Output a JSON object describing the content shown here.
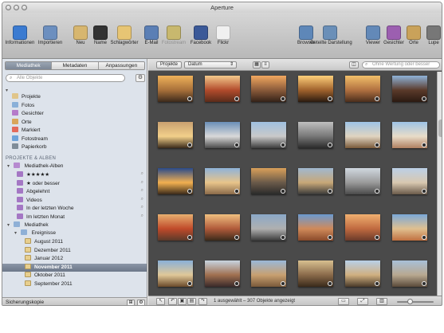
{
  "window": {
    "title": "Aperture"
  },
  "toolbar": {
    "left": [
      {
        "label": "Informationen",
        "icon": "info-icon",
        "color": "#3b7bd1"
      },
      {
        "label": "Importieren",
        "icon": "import-arrow-icon",
        "color": "#6c8fbf"
      },
      {
        "label": "Neu",
        "icon": "new-project-icon",
        "color": "#d7b66f"
      },
      {
        "label": "Name",
        "icon": "person-icon",
        "color": "#333333"
      },
      {
        "label": "Schlagwörter",
        "icon": "keyword-tag-icon",
        "color": "#e7c574"
      },
      {
        "label": "E-Mail",
        "icon": "email-icon",
        "color": "#5b7fb5"
      },
      {
        "label": "Fotostream",
        "icon": "photostream-icon",
        "color": "#c8b86e",
        "dim": true
      },
      {
        "label": "Facebook",
        "icon": "facebook-icon",
        "color": "#3b5998"
      },
      {
        "label": "Flickr",
        "icon": "flickr-icon",
        "color": "#f0f0f0"
      }
    ],
    "right": [
      {
        "label": "Browser",
        "icon": "browser-icon",
        "color": "#5e87b8"
      },
      {
        "label": "Geteilte Darstellung",
        "icon": "split-view-icon",
        "color": "#6a8fb8"
      },
      {
        "label": "Viewer",
        "icon": "viewer-icon",
        "color": "#6389b8"
      },
      {
        "label": "Gesichter",
        "icon": "faces-icon",
        "color": "#9c5fb0"
      },
      {
        "label": "Orte",
        "icon": "places-icon",
        "color": "#c9a25a"
      },
      {
        "label": "Lupe",
        "icon": "loupe-icon",
        "color": "#777777"
      }
    ]
  },
  "sidebar": {
    "tabs": [
      {
        "label": "Mediathek",
        "active": true
      },
      {
        "label": "Metadaten",
        "active": false
      },
      {
        "label": "Anpassungen",
        "active": false
      }
    ],
    "search_placeholder": "Alle Objekte",
    "library_items": [
      {
        "label": "Projekte",
        "icon": "projects-icon",
        "color": "#e0c58a"
      },
      {
        "label": "Fotos",
        "icon": "photos-icon",
        "color": "#8ab0d8"
      },
      {
        "label": "Gesichter",
        "icon": "faces-icon",
        "color": "#b57bc9"
      },
      {
        "label": "Orte",
        "icon": "places-icon",
        "color": "#d9a65a"
      },
      {
        "label": "Markiert",
        "icon": "flag-icon",
        "color": "#e36a5a"
      },
      {
        "label": "Fotostream",
        "icon": "photostream-icon",
        "color": "#6ea3d9"
      },
      {
        "label": "Papierkorb",
        "icon": "trash-icon",
        "color": "#7f8c98"
      }
    ],
    "section_label": "PROJEKTE & ALBEN",
    "albums_group": "Mediathek-Alben",
    "albums": [
      {
        "label": "★★★★★"
      },
      {
        "label": "★ oder besser"
      },
      {
        "label": "Abgelehnt"
      },
      {
        "label": "Videos"
      },
      {
        "label": "In der letzten Woche"
      },
      {
        "label": "Im letzten Monat"
      }
    ],
    "library_folder": "Mediathek",
    "events_folder": "Ereignisse",
    "events": [
      {
        "label": "August 2011",
        "selected": false
      },
      {
        "label": "Dezember 2011",
        "selected": false
      },
      {
        "label": "Januar 2012",
        "selected": false
      },
      {
        "label": "November 2011",
        "selected": true
      },
      {
        "label": "Oktober 2011",
        "selected": false
      },
      {
        "label": "September 2011",
        "selected": false
      }
    ],
    "bottom_label": "Sicherungskopie"
  },
  "browser": {
    "scope_button": "Projekte",
    "sort_select": "Datum",
    "filter_placeholder": "Ohne Wertung oder besser",
    "status": "1 ausgewählt – 307 Objekte angezeigt",
    "thumb_zoom": 0.35,
    "thumbnails": [
      {
        "colors": [
          "#f0b25a",
          "#a8703a",
          "#3c2a1c"
        ]
      },
      {
        "colors": [
          "#f3c98c",
          "#b24b2c",
          "#5a2b1a"
        ]
      },
      {
        "colors": [
          "#f2a860",
          "#8a5a3a",
          "#332218"
        ]
      },
      {
        "colors": [
          "#ffd07a",
          "#a0622c",
          "#2a1b10"
        ]
      },
      {
        "colors": [
          "#f2c06a",
          "#b07040",
          "#4a2e1c"
        ]
      },
      {
        "colors": [
          "#8fb3d9",
          "#5a3a2a",
          "#2b1a12"
        ]
      },
      {
        "colors": [
          "#c8a070",
          "#f2d08a",
          "#3a2a1a"
        ]
      },
      {
        "colors": [
          "#6a8fb8",
          "#d9d9d9",
          "#4a4a4a"
        ]
      },
      {
        "colors": [
          "#9fc0e0",
          "#c9c9c9",
          "#3c3c3c"
        ]
      },
      {
        "colors": [
          "#bfbfbf",
          "#777777",
          "#2a2a2a"
        ]
      },
      {
        "colors": [
          "#9ec3e6",
          "#e0d4c0",
          "#7a5a3a"
        ]
      },
      {
        "colors": [
          "#9ec3e6",
          "#e8dcc8",
          "#b08060"
        ]
      },
      {
        "colors": [
          "#2a4a8a",
          "#f2b050",
          "#3a2a1a"
        ]
      },
      {
        "colors": [
          "#8fb3d9",
          "#e8c48a",
          "#8a6a4a"
        ]
      },
      {
        "colors": [
          "#d9a05a",
          "#6a5a4a",
          "#2a2a2a"
        ]
      },
      {
        "colors": [
          "#a0b8d0",
          "#c8a878",
          "#3a3a3a"
        ]
      },
      {
        "colors": [
          "#d0d8e0",
          "#9a9a9a",
          "#4a4a4a"
        ]
      },
      {
        "colors": [
          "#bcd0e6",
          "#d8c8b0",
          "#6a5a4a"
        ]
      },
      {
        "colors": [
          "#e8b070",
          "#c04a2a",
          "#5a3a2a"
        ]
      },
      {
        "colors": [
          "#f0c080",
          "#b05a3a",
          "#3a2a1a"
        ]
      },
      {
        "colors": [
          "#8aa8c8",
          "#b0b0b0",
          "#3a3a3a"
        ]
      },
      {
        "colors": [
          "#6a9ad0",
          "#d08a5a",
          "#8a4a2a"
        ]
      },
      {
        "colors": [
          "#f0b070",
          "#c06a40",
          "#6a3a2a"
        ]
      },
      {
        "colors": [
          "#7aa8d8",
          "#e0c090",
          "#c07040"
        ]
      },
      {
        "colors": [
          "#8ab0d8",
          "#e0c898",
          "#6a4a2a"
        ]
      },
      {
        "colors": [
          "#c8d4e0",
          "#a07050",
          "#3a2a2a"
        ]
      },
      {
        "colors": [
          "#9ab8d8",
          "#c8a070",
          "#7a5a3a"
        ]
      },
      {
        "colors": [
          "#d8c090",
          "#8a6a4a",
          "#3a2a1a"
        ]
      },
      {
        "colors": [
          "#b8d0e8",
          "#d0b080",
          "#4a3a2a"
        ]
      },
      {
        "colors": [
          "#a8c0d8",
          "#b8a890",
          "#5a4a3a"
        ]
      }
    ]
  }
}
